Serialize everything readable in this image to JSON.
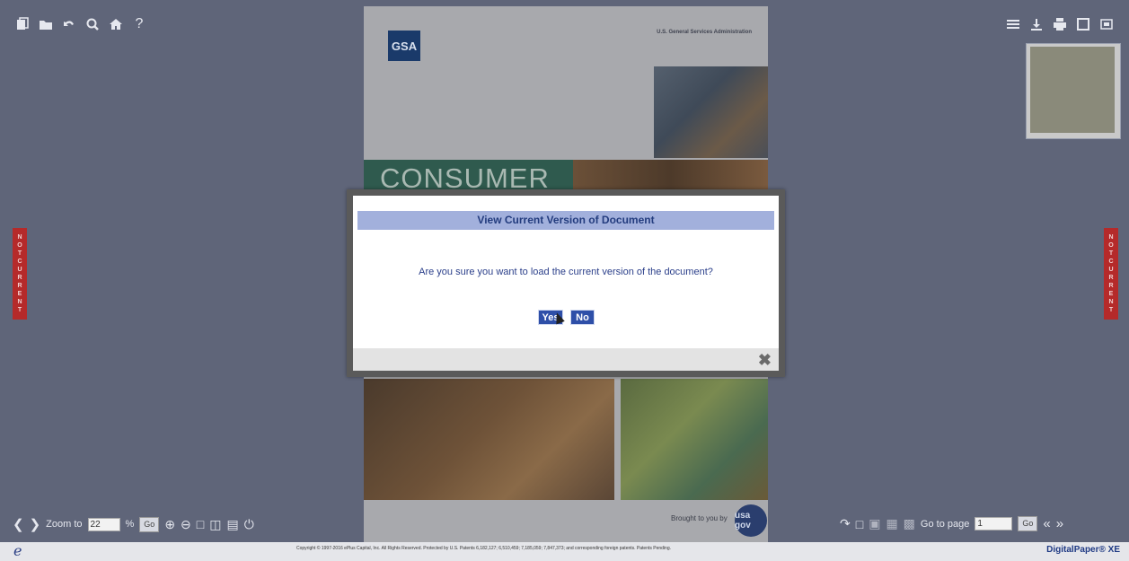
{
  "toolbar_left": {
    "icons": [
      "pages-icon",
      "folder-icon",
      "undo-icon",
      "search-icon",
      "home-icon",
      "help-icon"
    ],
    "help_label": "?"
  },
  "toolbar_right": {
    "icons": [
      "list-icon",
      "download-icon",
      "print-icon",
      "single-page-icon",
      "fullscreen-icon"
    ]
  },
  "not_current": {
    "label": "NOT CURRENT"
  },
  "document": {
    "publisher": "U.S. General Services Administration",
    "logo": "GSA",
    "cover_title": "CONSUMER",
    "brought_label": "Brought to you by",
    "usa_logo": "usa gov"
  },
  "dialog": {
    "title": "View Current Version of Document",
    "message": "Are you sure you want to load the current version of the document?",
    "yes_label": "Yes",
    "no_label": "No",
    "close_glyph": "✖"
  },
  "bottom_left": {
    "zoom_label": "Zoom to",
    "zoom_value": "22",
    "percent": "%",
    "go_label": "Go"
  },
  "bottom_right": {
    "goto_label": "Go to page",
    "page_value": "1",
    "go_label": "Go"
  },
  "footer": {
    "brand_mark": "e",
    "copyright": "Copyright © 1997-2016 ePlus Capital, Inc. All Rights Reserved. Protected by U.S. Patents 6,182,127; 6,510,459; 7,185,059; 7,847,373; and corresponding foreign patents. Patents Pending.",
    "product": "DigitalPaper® XE"
  },
  "colors": {
    "stage": "#5f6579",
    "dialog_title_bg": "#a2b0dc",
    "button": "#2e4fa8",
    "not_current": "#b52a2a"
  }
}
